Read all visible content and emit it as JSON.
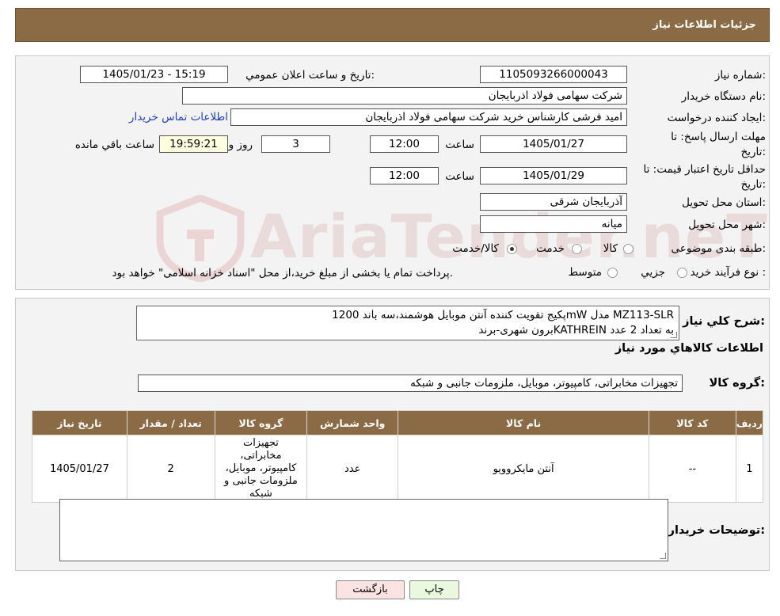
{
  "header": {
    "title": "جزئیات اطلاعات نیاز"
  },
  "form": {
    "need_number_label": "شماره نیاز:",
    "need_number": "1105093266000043",
    "announce_label": "تاریخ و ساعت اعلان عمومي:",
    "announce_value": "1405/01/23 - 15:19",
    "buyer_org_label": "نام دستگاه خريدار:",
    "buyer_org": "شرکت سهامی فولاد اذربایجان",
    "creator_label": "ايجاد کننده درخواست:",
    "creator": "امید فرشی کارشناس خرید شرکت سهامی فولاد اذربایجان",
    "contact_link": "اطلاعات تماس خريدار",
    "deadline_label_1": "مهلت ارسال پاسخ: تا",
    "deadline_label_2": "تاريخ:",
    "deadline_date": "1405/01/27",
    "time_label": "ساعت",
    "deadline_time": "12:00",
    "days_value": "3",
    "days_label": "روز و",
    "remaining_time": "19:59:21",
    "remaining_label": "ساعت باقي مانده",
    "validity_label_1": "حداقل تاريخ اعتبار قيمت: تا",
    "validity_label_2": "تاريخ:",
    "validity_date": "1405/01/29",
    "validity_time": "12:00",
    "province_label": "استان محل تحويل:",
    "province": "آذربایجان شرقی",
    "city_label": "شهر محل تحويل:",
    "city": "میانه",
    "category_label": "طبقه بندی موضوعی:",
    "category_options": [
      "کالا",
      "خدمت",
      "کالا/خدمت"
    ],
    "process_label": "نوع فرآيند خريد :",
    "process_options": [
      "جزيي",
      "متوسط"
    ],
    "process_note": "پرداخت تمام يا بخشی از مبلغ خريد،از محل \"اسناد خزانه اسلامی\" خواهد بود."
  },
  "watermark": "AriaTender.neT",
  "description": {
    "label": "شرح كلي نياز:",
    "line1": "پکیج تقویت کننده آنتن موبایل هوشمند،سه باند 1200mW مدل MZ113-SLR",
    "line2": "برون شهری-برندKATHREIN به تعداد 2 عدد"
  },
  "goods": {
    "section_title": "اطلاعات كالاهاي مورد نياز",
    "group_label": "گروه كالا:",
    "group_value": "تجهیزات مخابراتی، کامپیوتر، موبایل، ملزومات جانبی و شبکه"
  },
  "table": {
    "headers": [
      "رديف",
      "كد كالا",
      "نام كالا",
      "واحد شمارش",
      "گروه كالا",
      "تعداد / مقدار",
      "تاريخ نياز"
    ],
    "rows": [
      {
        "row": "1",
        "code": "--",
        "name": "آنتن مایکروویو",
        "unit": "عدد",
        "group": "تجهیزات مخابراتی، کامپیوتر، موبایل، ملزومات جانبی و شبکه",
        "qty": "2",
        "date": "1405/01/27"
      }
    ]
  },
  "buyer_notes": {
    "label": "توضيحات خريدار:",
    "value": ""
  },
  "buttons": {
    "print": "چاپ",
    "back": "بازگشت"
  }
}
